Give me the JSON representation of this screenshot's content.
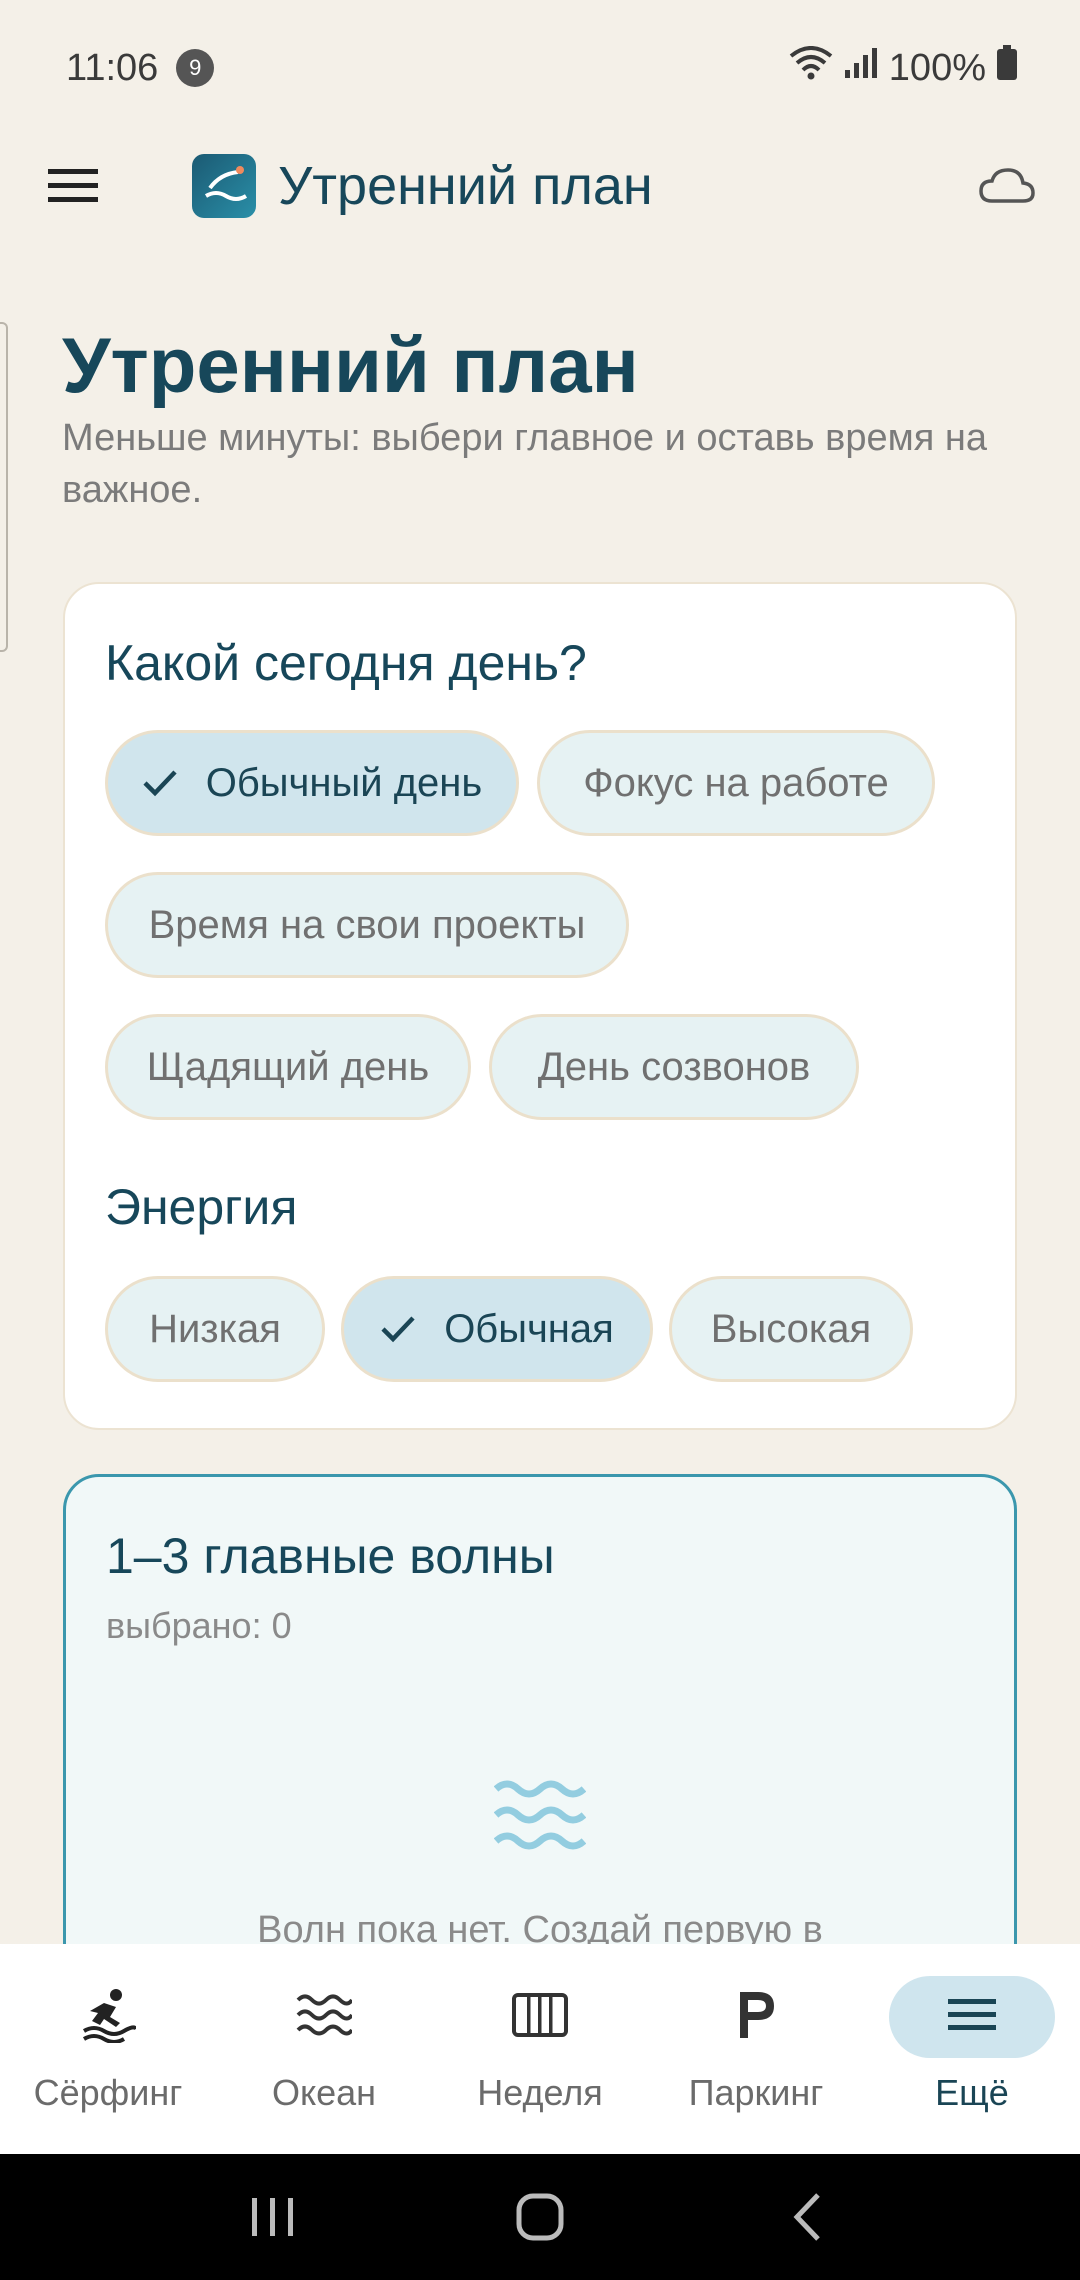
{
  "status": {
    "time": "11:06",
    "notification_count": "9",
    "battery": "100%"
  },
  "appbar": {
    "title": "Утренний план"
  },
  "page": {
    "title": "Утренний план",
    "subtitle": "Меньше минуты: выбери главное и оставь время на важное."
  },
  "day_type": {
    "heading": "Какой сегодня день?",
    "options": [
      {
        "label": "Обычный день",
        "selected": true
      },
      {
        "label": "Фокус на работе",
        "selected": false
      },
      {
        "label": "Время на свои проекты",
        "selected": false
      },
      {
        "label": "Щадящий день",
        "selected": false
      },
      {
        "label": "День созвонов",
        "selected": false
      }
    ]
  },
  "energy": {
    "heading": "Энергия",
    "options": [
      {
        "label": "Низкая",
        "selected": false
      },
      {
        "label": "Обычная",
        "selected": true
      },
      {
        "label": "Высокая",
        "selected": false
      }
    ]
  },
  "waves": {
    "title": "1–3 главные волны",
    "count_label": "выбрано: 0",
    "empty_text": "Волн пока нет. Создай первую в"
  },
  "bottom_nav": [
    {
      "label": "Сёрфинг",
      "icon": "surfer-icon",
      "active": false
    },
    {
      "label": "Океан",
      "icon": "waves-icon",
      "active": false
    },
    {
      "label": "Неделя",
      "icon": "week-columns-icon",
      "active": false
    },
    {
      "label": "Паркинг",
      "icon": "parking-icon",
      "active": false
    },
    {
      "label": "Ещё",
      "icon": "menu-icon",
      "active": true
    }
  ],
  "colors": {
    "background": "#f4f0e8",
    "primary_text": "#17475a",
    "selected_chip": "#d0e5ed",
    "chip": "#e6f2f3",
    "accent_border": "#3b97ad",
    "nav_active": "#cfe5ee"
  }
}
